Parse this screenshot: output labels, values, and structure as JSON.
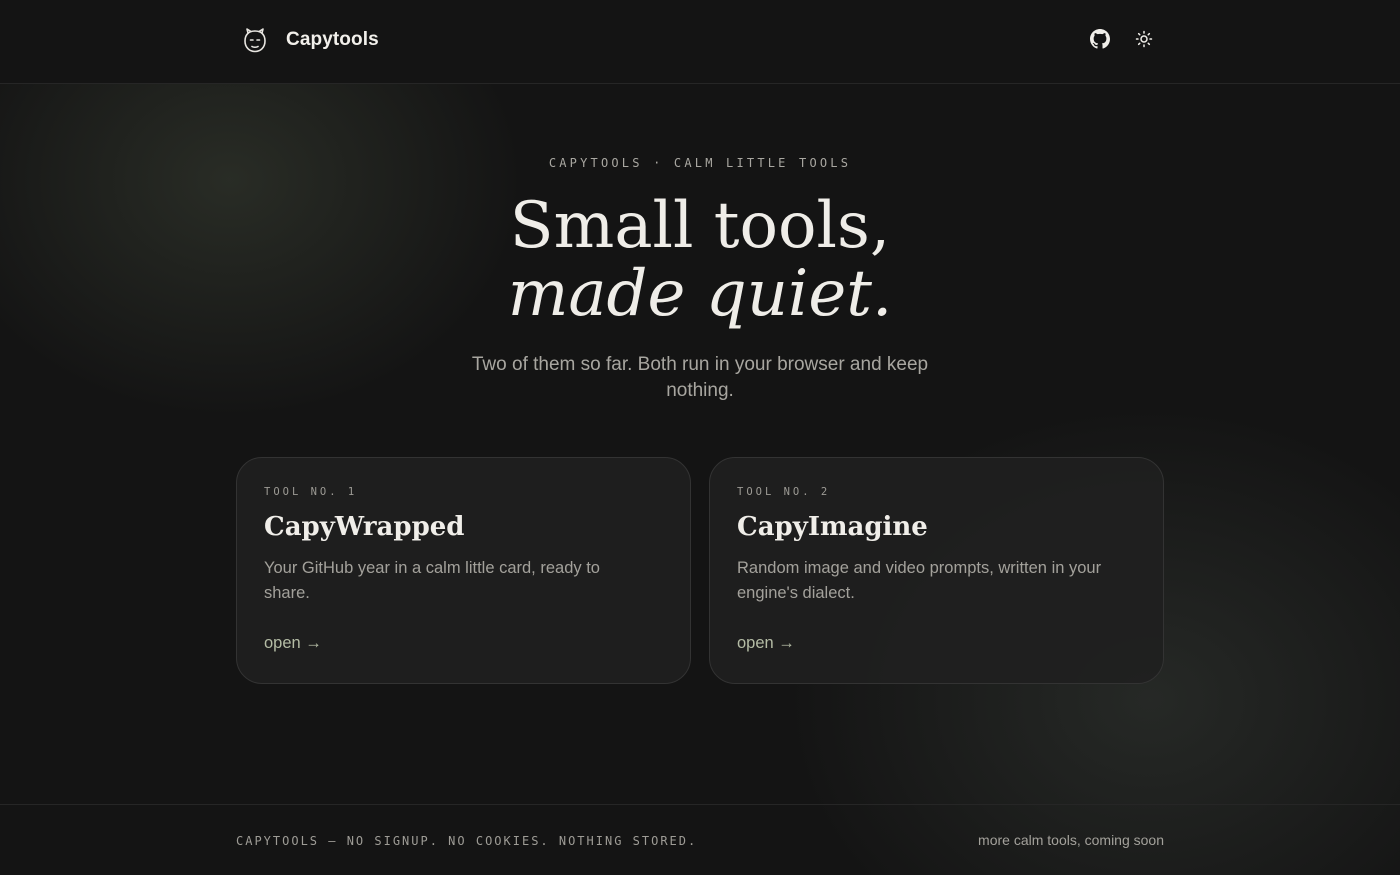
{
  "header": {
    "brand": "Capytools",
    "logo_icon": "capybara-face-icon",
    "github_icon": "github-icon",
    "theme_icon": "sun-icon"
  },
  "hero": {
    "eyebrow": "CAPYTOOLS · CALM LITTLE TOOLS",
    "title_line1": "Small tools,",
    "title_line2": "made quiet.",
    "subtitle": "Two of them so far. Both run in your browser and keep nothing."
  },
  "cards": [
    {
      "kicker": "TOOL NO. 1",
      "name": "CapyWrapped",
      "desc": "Your GitHub year in a calm little card, ready to share.",
      "open_label": "open →"
    },
    {
      "kicker": "TOOL NO. 2",
      "name": "CapyImagine",
      "desc": "Random image and video prompts, written in your engine's dialect.",
      "open_label": "open →"
    }
  ],
  "footer": {
    "left": "CAPYTOOLS — NO SIGNUP. NO COOKIES. NOTHING STORED.",
    "right": "more calm tools, coming soon"
  },
  "colors": {
    "background": "#141414",
    "card": "#202020",
    "accent": "#b4bca5",
    "text": "#efede8"
  }
}
